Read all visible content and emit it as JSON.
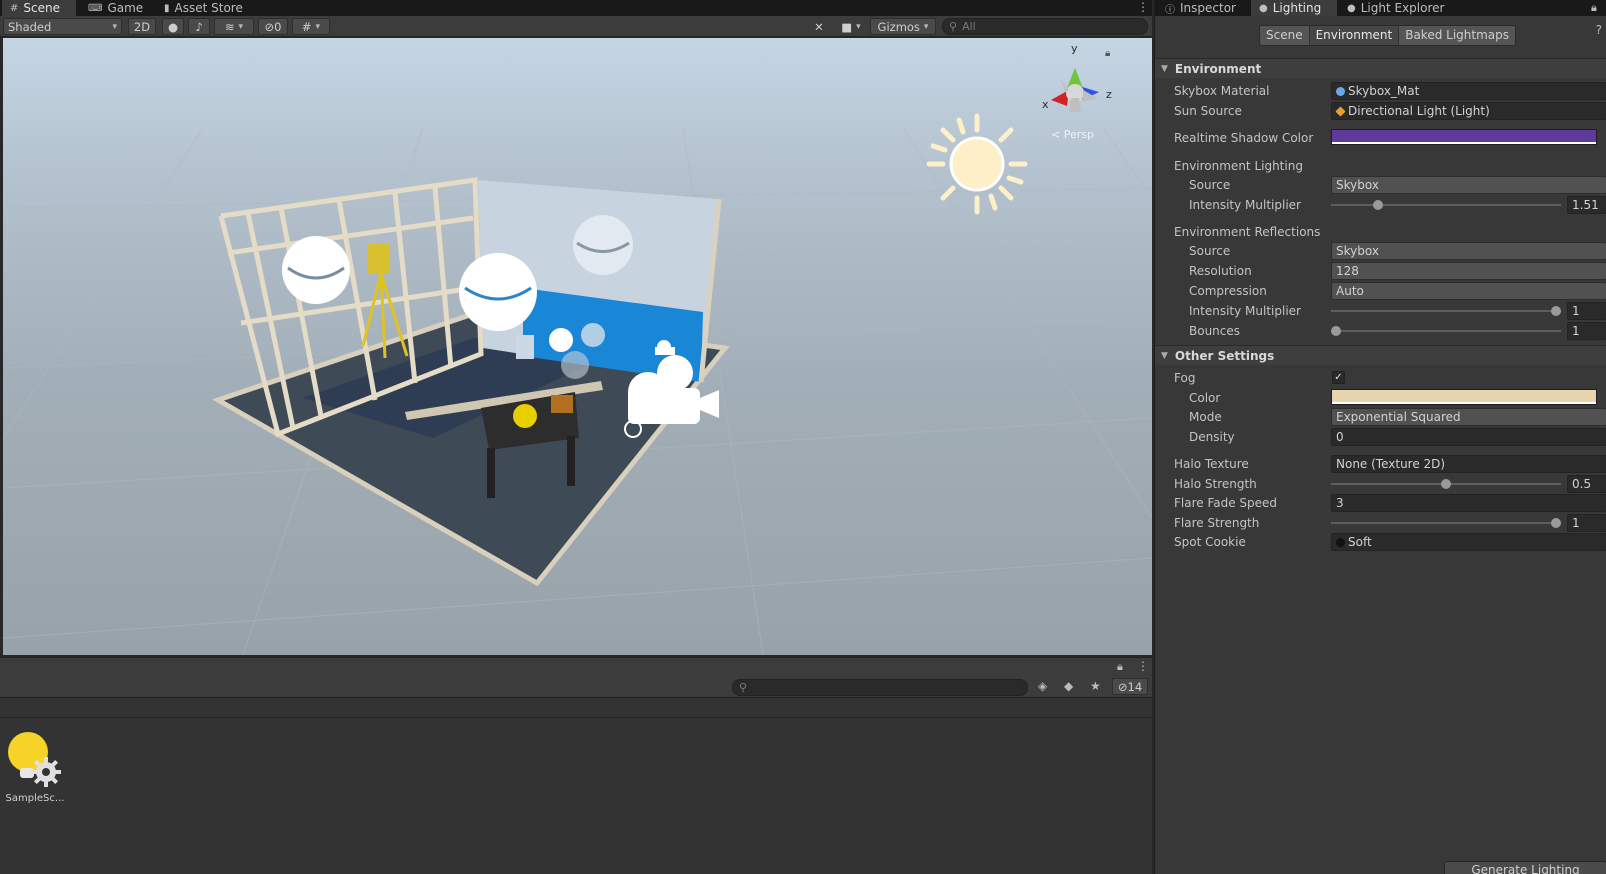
{
  "scene_panel": {
    "tabs": [
      {
        "label": "Scene",
        "icon": "hash-icon"
      },
      {
        "label": "Game",
        "icon": "gamepad-icon"
      },
      {
        "label": "Asset Store",
        "icon": "bag-icon"
      }
    ],
    "toolbar": {
      "shading_mode": "Shaded",
      "mode_2d": "2D",
      "hidden_count": "0",
      "gizmos": "Gizmos",
      "search_placeholder": "All"
    },
    "view": {
      "projection_label": "Persp",
      "axis_labels": {
        "y": "y",
        "x": "x",
        "z": "z"
      }
    }
  },
  "project_panel": {
    "hidden_count": "14",
    "assets": [
      {
        "label": "SampleSc...",
        "icon": "lighting-settings-icon"
      }
    ]
  },
  "inspector": {
    "tabs": [
      {
        "label": "Inspector",
        "icon": "info-icon"
      },
      {
        "label": "Lighting",
        "icon": "bulb-icon"
      },
      {
        "label": "Light Explorer",
        "icon": "bulb-icon"
      }
    ],
    "segments": [
      "Scene",
      "Environment",
      "Baked Lightmaps"
    ],
    "active_segment": "Environment",
    "environment": {
      "header": "Environment",
      "skybox_material": {
        "label": "Skybox Material",
        "value": "Skybox_Mat"
      },
      "sun_source": {
        "label": "Sun Source",
        "value": "Directional Light (Light)"
      },
      "shadow_color": {
        "label": "Realtime Shadow Color",
        "color": "#5d3a9b"
      },
      "env_lighting": {
        "label": "Environment Lighting",
        "source": {
          "label": "Source",
          "value": "Skybox"
        },
        "intensity": {
          "label": "Intensity Multiplier",
          "value": "1.51",
          "fraction": 0.19
        }
      },
      "env_reflections": {
        "label": "Environment Reflections",
        "source": {
          "label": "Source",
          "value": "Skybox"
        },
        "resolution": {
          "label": "Resolution",
          "value": "128"
        },
        "compression": {
          "label": "Compression",
          "value": "Auto"
        },
        "intensity": {
          "label": "Intensity Multiplier",
          "value": "1",
          "fraction": 1.0
        },
        "bounces": {
          "label": "Bounces",
          "value": "1",
          "fraction": 0.0
        }
      }
    },
    "other": {
      "header": "Other Settings",
      "fog": {
        "label": "Fog",
        "checked": "✓"
      },
      "fog_color": {
        "label": "Color",
        "color": "#e8d5b0"
      },
      "fog_mode": {
        "label": "Mode",
        "value": "Exponential Squared"
      },
      "fog_density": {
        "label": "Density",
        "value": "0"
      },
      "halo_texture": {
        "label": "Halo Texture",
        "value": "None (Texture 2D)"
      },
      "halo_strength": {
        "label": "Halo Strength",
        "value": "0.5",
        "fraction": 0.5
      },
      "flare_fade_speed": {
        "label": "Flare Fade Speed",
        "value": "3"
      },
      "flare_strength": {
        "label": "Flare Strength",
        "value": "1",
        "fraction": 1.0
      },
      "spot_cookie": {
        "label": "Spot Cookie",
        "value": "Soft"
      }
    },
    "generate_button": "Generate Lighting"
  }
}
